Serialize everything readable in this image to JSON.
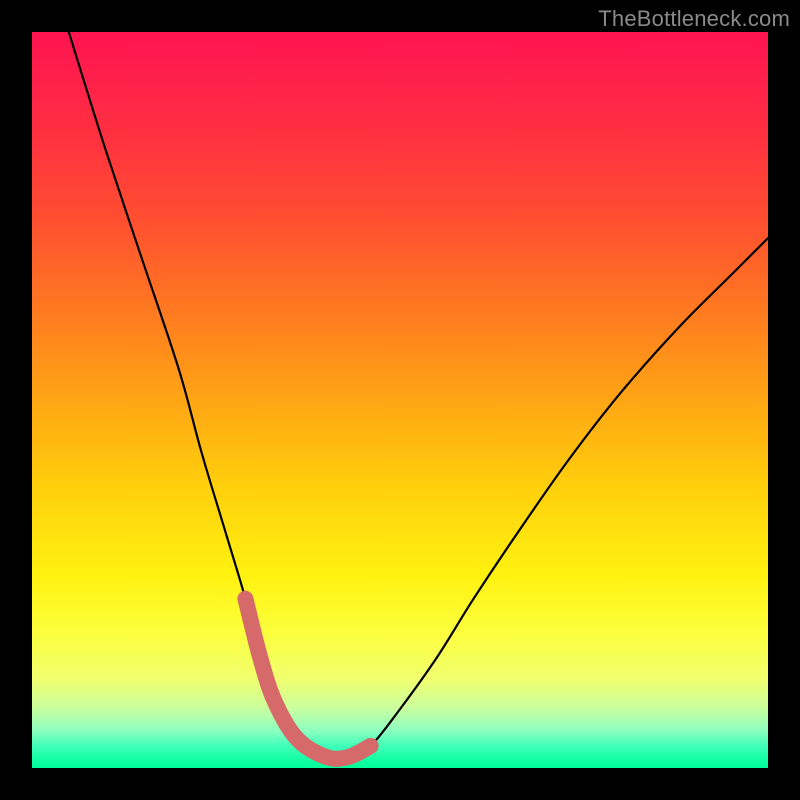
{
  "watermark": {
    "text": "TheBottleneck.com"
  },
  "colors": {
    "curve": "#000000",
    "highlight": "#d66a6a",
    "background_frame": "#000000"
  },
  "chart_data": {
    "type": "line",
    "title": "",
    "xlabel": "",
    "ylabel": "",
    "xlim": [
      0,
      100
    ],
    "ylim": [
      0,
      100
    ],
    "note": "Axes are unlabeled in the image; values are estimated from pixel positions in a 736×736 plot area. y=0 is bottom (valley), y=100 is top.",
    "series": [
      {
        "name": "bottleneck-curve",
        "x": [
          5,
          10,
          15,
          20,
          23,
          26,
          29,
          31,
          33,
          36,
          40,
          43,
          46,
          50,
          55,
          60,
          66,
          73,
          80,
          88,
          95,
          100
        ],
        "y": [
          100,
          84,
          69,
          54,
          43,
          33,
          23,
          15,
          9,
          4,
          1.5,
          1.5,
          3,
          8,
          15,
          23,
          32,
          42,
          51,
          60,
          67,
          72
        ]
      },
      {
        "name": "optimal-range-highlight",
        "x": [
          29,
          31,
          33,
          36,
          40,
          43,
          46
        ],
        "y": [
          23,
          15,
          9,
          4,
          1.5,
          1.5,
          3
        ]
      }
    ],
    "highlight_x_range": [
      29,
      46
    ]
  }
}
